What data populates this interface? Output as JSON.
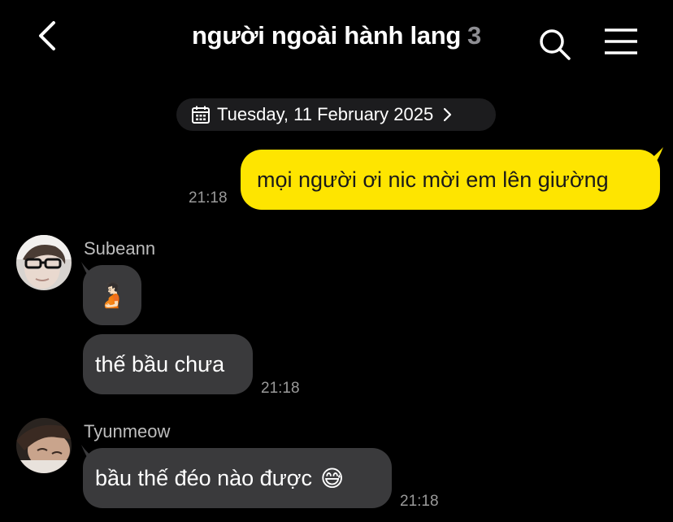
{
  "header": {
    "title": "người ngoài hành lang",
    "member_count": "3"
  },
  "date_separator": {
    "label": "Tuesday, 11 February 2025"
  },
  "messages": [
    {
      "sender": "",
      "text": "mọi người ơi nic mời em lên giường",
      "time": "21:18",
      "outgoing": true
    },
    {
      "sender": "Subeann",
      "emoji": "🫄🏻",
      "time": ""
    },
    {
      "sender": "",
      "text": "thế bầu chưa",
      "time": "21:18"
    },
    {
      "sender": "Tyunmeow",
      "text": "bầu thế đéo nào được",
      "emoji": "😅",
      "time": "21:18"
    }
  ],
  "colors": {
    "background": "#000000",
    "outgoing_bubble": "#fee500",
    "incoming_bubble": "#3a3a3c"
  }
}
